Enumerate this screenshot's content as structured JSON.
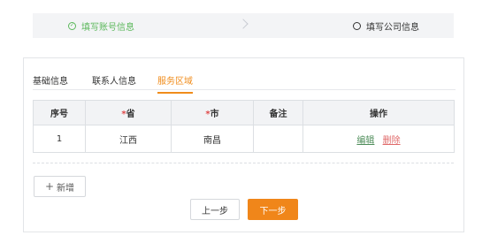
{
  "stepper": {
    "step1_label": "填写账号信息",
    "step2_label": "填写公司信息",
    "done_icon_glyph": "✓"
  },
  "tabs": [
    {
      "label": "基础信息",
      "active": false
    },
    {
      "label": "联系人信息",
      "active": false
    },
    {
      "label": "服务区域",
      "active": true
    }
  ],
  "table": {
    "headers": {
      "index": "序号",
      "province": "省",
      "city": "市",
      "note": "备注",
      "actions": "操作"
    },
    "required_mark": "*",
    "rows": [
      {
        "index": "1",
        "province": "江西",
        "city": "南昌",
        "note": "",
        "edit": "编辑",
        "delete": "删除"
      }
    ]
  },
  "buttons": {
    "add_icon": "+",
    "add_label": "新增",
    "prev_label": "上一步",
    "next_label": "下一步"
  },
  "colors": {
    "accent": "#f0861a",
    "success": "#5cb85c",
    "edit_link": "#4e8d5a",
    "delete_link": "#e06a6a",
    "required": "#e04848"
  }
}
